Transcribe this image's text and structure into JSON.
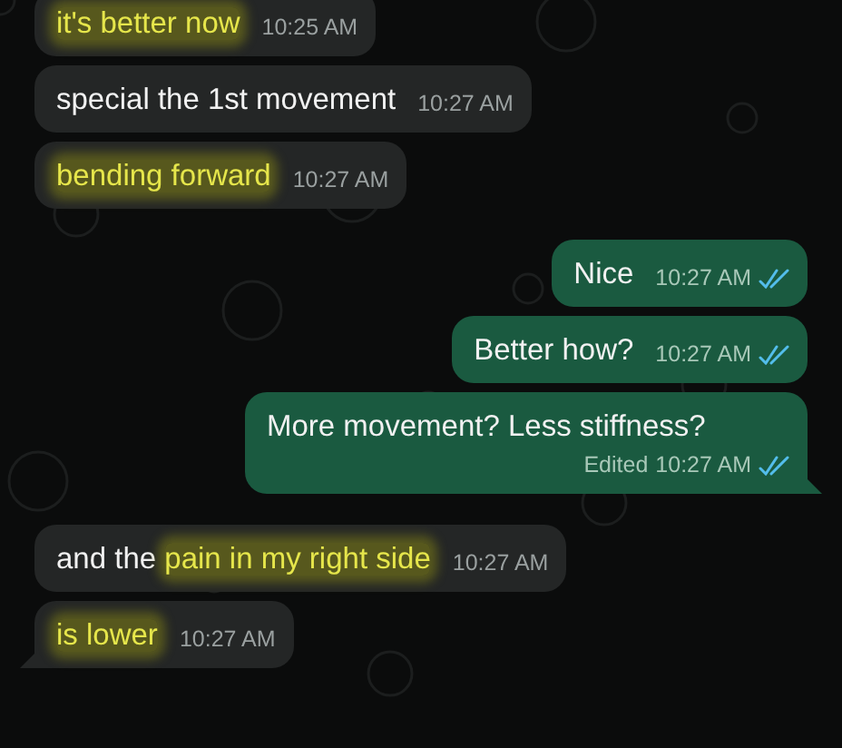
{
  "messages": [
    {
      "kind": "incoming",
      "parts": [
        {
          "text": "it's better now",
          "highlighted": true
        }
      ],
      "time": "10:25 AM",
      "tail": false
    },
    {
      "kind": "incoming",
      "parts": [
        {
          "text": "special the 1st movement",
          "highlighted": false
        }
      ],
      "time": "10:27 AM",
      "tail": false
    },
    {
      "kind": "incoming",
      "parts": [
        {
          "text": "bending forward",
          "highlighted": true
        }
      ],
      "time": "10:27 AM",
      "tail": false
    },
    {
      "kind": "outgoing",
      "parts": [
        {
          "text": "Nice",
          "highlighted": false
        }
      ],
      "time": "10:27 AM",
      "read": true,
      "tail": false
    },
    {
      "kind": "outgoing",
      "parts": [
        {
          "text": "Better how?",
          "highlighted": false
        }
      ],
      "time": "10:27 AM",
      "read": true,
      "tail": false
    },
    {
      "kind": "outgoing",
      "parts": [
        {
          "text": "More movement? Less stiffness?",
          "highlighted": false
        }
      ],
      "edited": "Edited",
      "time": "10:27 AM",
      "read": true,
      "tail": true
    },
    {
      "kind": "incoming",
      "parts": [
        {
          "text": "and the ",
          "highlighted": false
        },
        {
          "text": "pain in my right side",
          "highlighted": true
        }
      ],
      "time": "10:27 AM",
      "tail": false
    },
    {
      "kind": "incoming",
      "parts": [
        {
          "text": "is lower",
          "highlighted": true
        }
      ],
      "time": "10:27 AM",
      "tail": true
    }
  ]
}
